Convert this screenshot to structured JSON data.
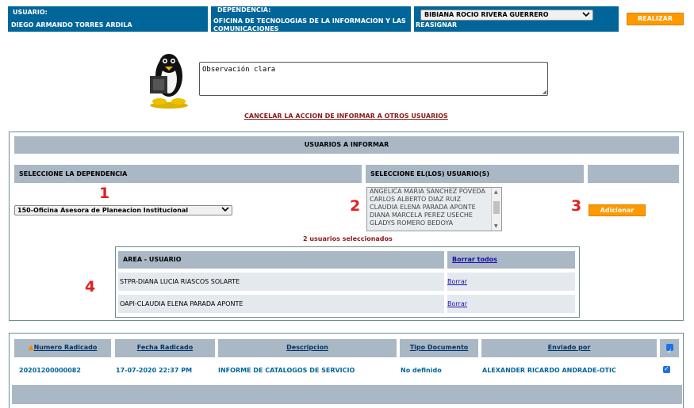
{
  "header": {
    "usuario_label": "USUARIO:",
    "usuario_name": "DIEGO ARMANDO TORRES ARDILA",
    "dependencia_label": "DEPENDENCIA:",
    "dependencia_name": "OFICINA DE TECNOLOGIAS DE LA INFORMACION Y LAS COMUNICACIONES",
    "reasignar_selected": "BIBIANA ROCIO RIVERA GUERRERO",
    "reasignar_label": "REASIGNAR",
    "realizar_label": "REALIZAR"
  },
  "observation": {
    "text": "Observación clara"
  },
  "cancel_link": "CANCELAR LA ACCION DE INFORMAR A OTROS USUARIOS",
  "informar": {
    "title": "USUARIOS A INFORMAR",
    "dep_header": "SELECCIONE LA DEPENDENCIA",
    "users_header": "SELECCIONE EL(LOS) USUARIO(S)",
    "dep_selected": "150-Oficina Asesora de Planeacion Institucional",
    "users_options": [
      "ANGELICA MARIA SANCHEZ POVEDA",
      "CARLOS ALBERTO DIAZ RUIZ",
      "CLAUDIA ELENA PARADA APONTE",
      "DIANA MARCELA PEREZ USECHE",
      "GLADYS ROMERO BEDOYA"
    ],
    "adicionar_label": "Adicionar",
    "selected_count": "2 usuarios seleccionados",
    "marker_1": "1",
    "marker_2": "2",
    "marker_3": "3",
    "marker_4": "4"
  },
  "selected_table": {
    "col_area": "AREA - USUARIO",
    "borrar_todos": "Borrar todos",
    "rows": [
      {
        "area": "STPR-DIANA LUCIA RIASCOS SOLARTE",
        "action": "Borrar"
      },
      {
        "area": "OAPI-CLAUDIA ELENA PARADA APONTE",
        "action": "Borrar"
      }
    ]
  },
  "radicados": {
    "headers": [
      "Numero Radicado",
      "Fecha Radicado",
      "Descripcion",
      "Tipo Documento",
      "Enviado por"
    ],
    "row": {
      "numero": "20201200000082",
      "fecha": "17-07-2020 22:37 PM",
      "descripcion": "INFORME DE CATALOGOS DE SERVICIO",
      "tipo": "No definido",
      "enviado": "ALEXANDER RICARDO ANDRADE-OTIC"
    }
  },
  "colors": {
    "header_blue": "#006699",
    "accent_orange": "#ff9900",
    "grey_bar": "#a9b8c4",
    "marker_red": "#e02020",
    "link_maroon": "#8b1a1a"
  },
  "icons": [
    "penguin-icon",
    "chevron-down-icon",
    "sort-up-icon",
    "checkbox-icon"
  ]
}
